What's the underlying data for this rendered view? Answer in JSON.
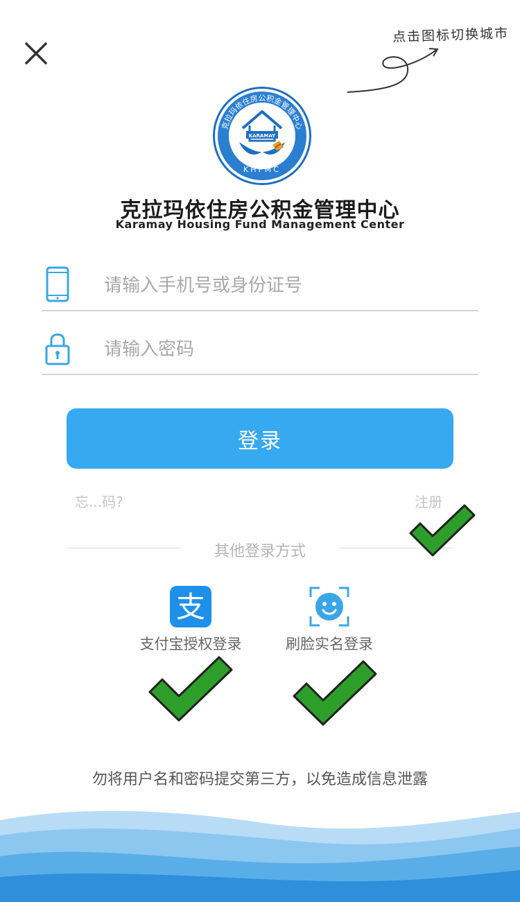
{
  "hint": {
    "text": "点击图标切换城市"
  },
  "organization": {
    "name_cn": "克拉玛依住房公积金管理中心",
    "name_en": "Karamay Housing Fund Management Center",
    "logo": {
      "ring_text": "克拉玛依住房公积金管理中心",
      "badge_text": "KARAMAY",
      "bottom_text": "KHFMC"
    }
  },
  "form": {
    "account_placeholder": "请输入手机号或身份证号",
    "password_placeholder": "请输入密码",
    "login_label": "登录",
    "forgot_label": "忘...码?",
    "register_label": "注册"
  },
  "other_login": {
    "title": "其他登录方式",
    "alipay_label": "支付宝授权登录",
    "face_label": "刷脸实名登录",
    "alipay_glyph": "支"
  },
  "notice": "勿将用户名和密码提交第三方，以免造成信息泄露",
  "icons": {
    "close": "close-icon",
    "phone": "phone-icon",
    "lock": "lock-icon",
    "alipay": "alipay-icon",
    "face": "face-scan-icon",
    "check": "check-mark-icon"
  },
  "colors": {
    "primary": "#36a9f0",
    "check_green": "#2e9e2a",
    "logo_blue": "#1e6fc0"
  }
}
